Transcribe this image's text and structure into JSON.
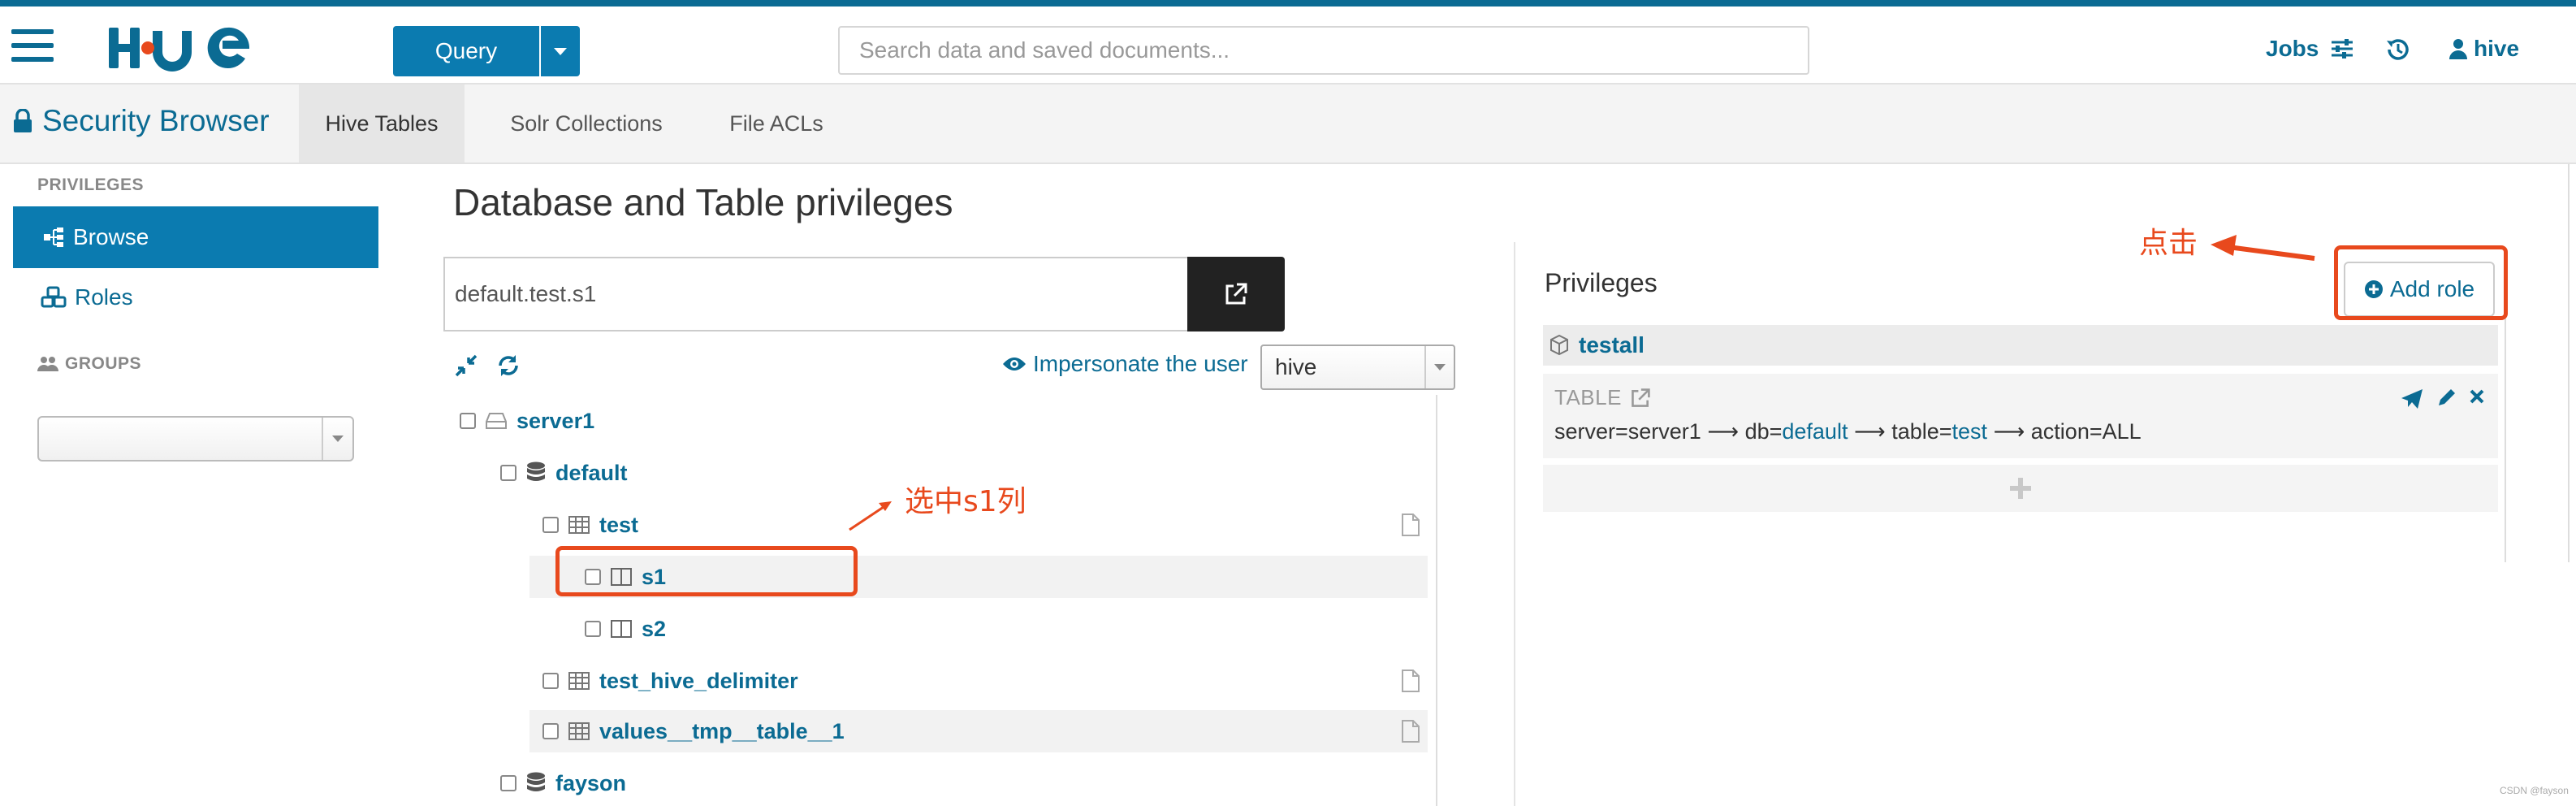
{
  "navbar": {
    "query_label": "Query",
    "search_placeholder": "Search data and saved documents...",
    "jobs_label": "Jobs",
    "user_label": "hive"
  },
  "subnav": {
    "app_title": "Security Browser",
    "tabs": [
      {
        "label": "Hive Tables",
        "active": true
      },
      {
        "label": "Solr Collections",
        "active": false
      },
      {
        "label": "File ACLs",
        "active": false
      }
    ]
  },
  "sidebar": {
    "privileges_header": "PRIVILEGES",
    "browse_label": "Browse",
    "roles_label": "Roles",
    "groups_header": "GROUPS",
    "groups_select_value": ""
  },
  "main": {
    "title": "Database and Table privileges",
    "path_value": "default.test.s1",
    "impersonate_label": "Impersonate the user",
    "impersonate_value": "hive",
    "tree": [
      {
        "label": "server1",
        "type": "server",
        "level": 0
      },
      {
        "label": "default",
        "type": "database",
        "level": 1
      },
      {
        "label": "test",
        "type": "table",
        "level": 2,
        "has_doc": true
      },
      {
        "label": "s1",
        "type": "column",
        "level": 3,
        "selected": true
      },
      {
        "label": "s2",
        "type": "column",
        "level": 3
      },
      {
        "label": "test_hive_delimiter",
        "type": "table",
        "level": 2,
        "has_doc": true
      },
      {
        "label": "values__tmp__table__1",
        "type": "table",
        "level": 2,
        "has_doc": true
      },
      {
        "label": "fayson",
        "type": "database",
        "level": 1
      }
    ]
  },
  "privileges": {
    "title": "Privileges",
    "add_role_label": "Add role",
    "role_name": "testall",
    "card": {
      "type": "TABLE",
      "server_prefix": "server=server1",
      "db_key": "db=",
      "db_value": "default",
      "table_key": "table=",
      "table_value": "test",
      "action": "action=ALL"
    }
  },
  "annotations": {
    "select_note": "选中s1列",
    "click_note": "点击"
  },
  "watermark": "CSDN @fayson",
  "colors": {
    "accent": "#0b6b93",
    "button": "#0b7bb0",
    "annotation": "#e8491d"
  }
}
